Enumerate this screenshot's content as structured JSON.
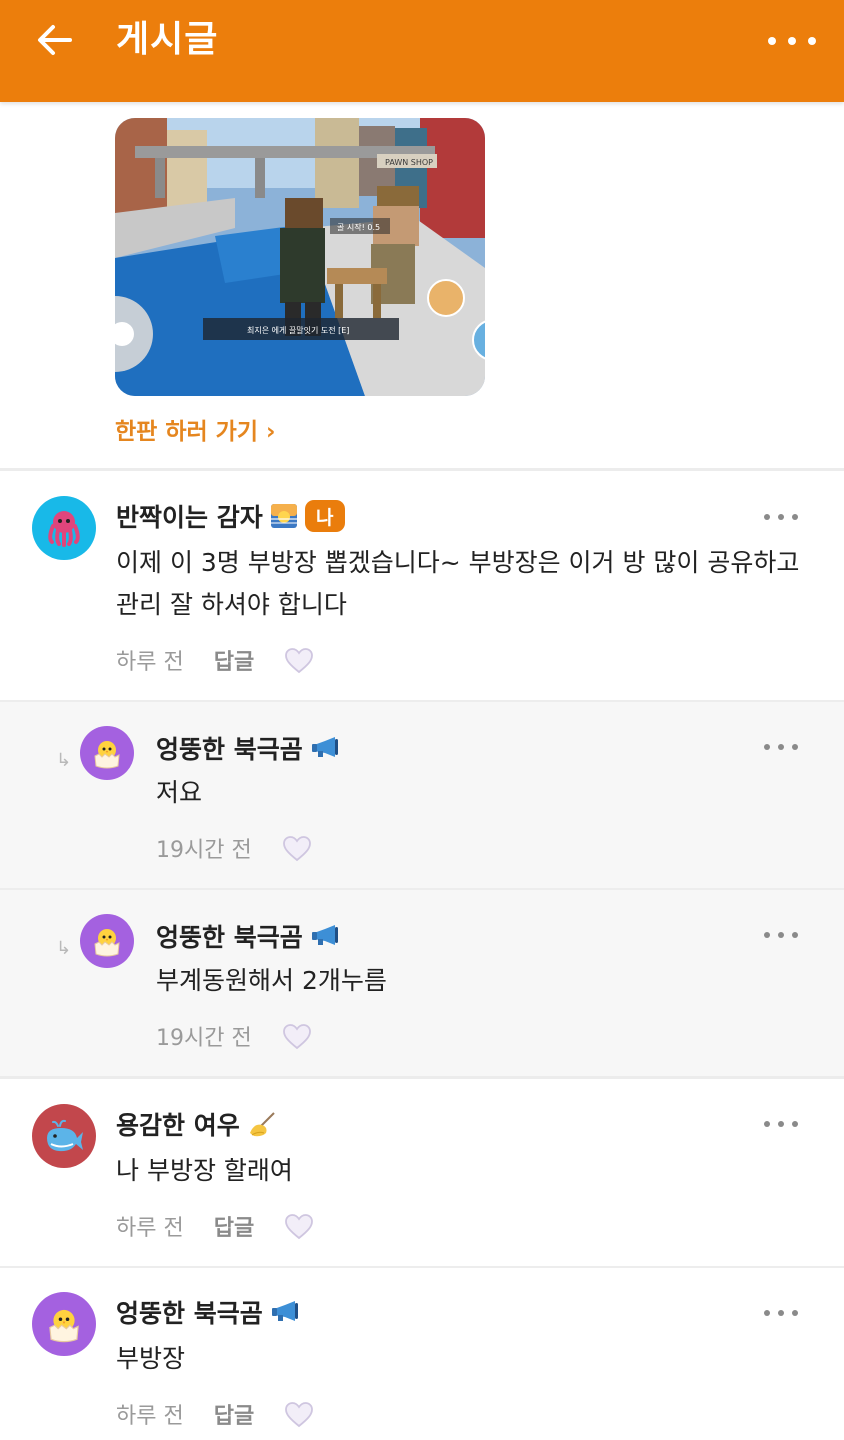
{
  "header": {
    "title": "게시글",
    "bg_color": "#ec7e0c"
  },
  "post": {
    "image_text_top": "골 시작! 0.5",
    "image_text_bottom": "최지은 에게 끌말잇기 도전 [E]",
    "image_sign": "PAWN SHOP",
    "play_link": "한판 하러 가기 ›"
  },
  "comments": [
    {
      "username": "반짝이는 감자",
      "badge": "나",
      "name_emoji": "sunrise-emoji",
      "avatar_icon": "octopus-icon",
      "avatar_color": "#18b9e8",
      "text_line1": "이제 이 3명 부방장 뽑겠습니다~ 부방장은 이거 방 많이 공유하고",
      "text_line2": "관리 잘 하셔야 합니다",
      "time": "하루 전",
      "reply_label": "답글"
    },
    {
      "username": "엉뚱한 북극곰",
      "name_emoji": "megaphone-emoji",
      "avatar_icon": "hatching-chick-icon",
      "avatar_color": "#a461e0",
      "text": "저요",
      "time": "19시간 전"
    },
    {
      "username": "엉뚱한 북극곰",
      "name_emoji": "megaphone-emoji",
      "avatar_icon": "hatching-chick-icon",
      "avatar_color": "#a461e0",
      "text": "부계동원해서 2개누름",
      "time": "19시간 전"
    },
    {
      "username": "용감한 여우",
      "name_emoji": "writing-hand-emoji",
      "avatar_icon": "whale-icon",
      "avatar_color": "#c2474c",
      "text": "나 부방장 할래여",
      "time": "하루 전",
      "reply_label": "답글"
    },
    {
      "username": "엉뚱한 북극곰",
      "name_emoji": "megaphone-emoji",
      "avatar_icon": "hatching-chick-icon",
      "avatar_color": "#a461e0",
      "text": "부방장",
      "time": "하루 전",
      "reply_label": "답글"
    }
  ]
}
